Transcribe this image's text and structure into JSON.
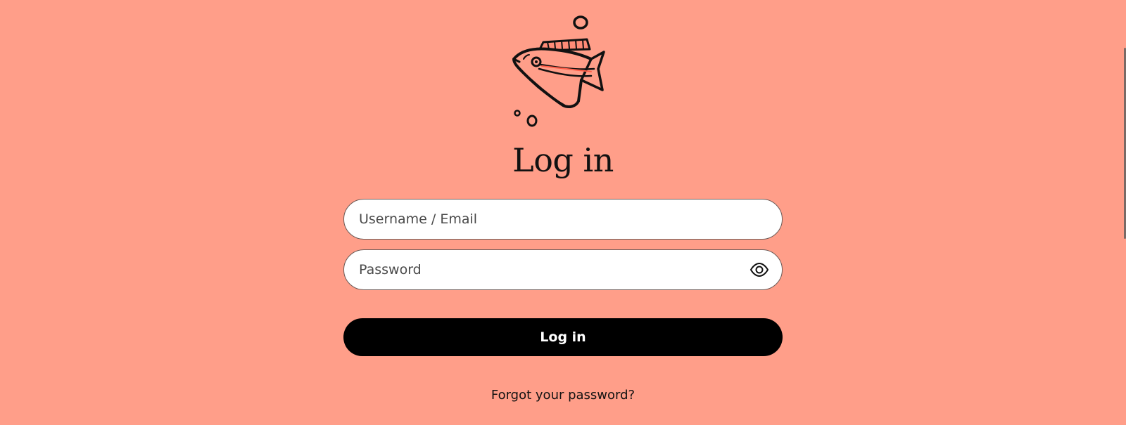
{
  "page": {
    "background_color": "#ff9e89",
    "logo_icon": "fish-illustration"
  },
  "login": {
    "title": "Log in",
    "username_placeholder": "Username / Email",
    "password_placeholder": "Password",
    "show_password_icon": "eye-icon",
    "submit_label": "Log in",
    "forgot_password": "Forgot your password?"
  }
}
